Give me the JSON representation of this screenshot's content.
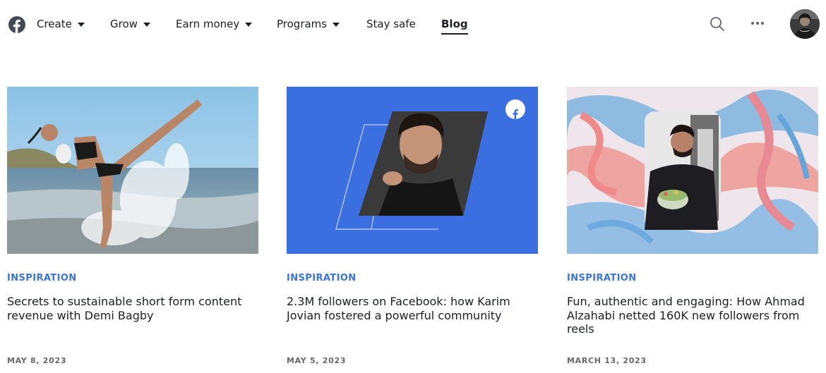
{
  "nav": {
    "logo_icon": "facebook-logo-icon",
    "items": [
      {
        "label": "Create",
        "has_dropdown": true
      },
      {
        "label": "Grow",
        "has_dropdown": true
      },
      {
        "label": "Earn money",
        "has_dropdown": true
      },
      {
        "label": "Programs",
        "has_dropdown": true
      },
      {
        "label": "Stay safe",
        "has_dropdown": false
      },
      {
        "label": "Blog",
        "has_dropdown": false,
        "active": true
      }
    ],
    "search_icon": "search-icon",
    "more_icon": "more-horizontal-icon",
    "avatar": "profile-avatar"
  },
  "articles": [
    {
      "image": "photo of kickboxer kicking in ocean surf",
      "category": "INSPIRATION",
      "title": "Secrets to sustainable short form content revenue with Demi Bagby",
      "date": "MAY 8, 2023"
    },
    {
      "image": "portrait of man on blue background with facebook logo",
      "category": "INSPIRATION",
      "title": "2.3M followers on Facebook: how Karim Jovian fostered a powerful community",
      "date": "MAY 5, 2023"
    },
    {
      "image": "man holding bowl of salad on marbled pink and blue background",
      "category": "INSPIRATION",
      "title": "Fun, authentic and engaging: How Ahmad Alzahabi netted 160K new followers from reels",
      "date": "MARCH 13, 2023"
    }
  ],
  "colors": {
    "accent_blue": "#3b74d4",
    "facebook_blue": "#3b6fe0",
    "text": "#1c1e21",
    "muted": "#65676b"
  }
}
